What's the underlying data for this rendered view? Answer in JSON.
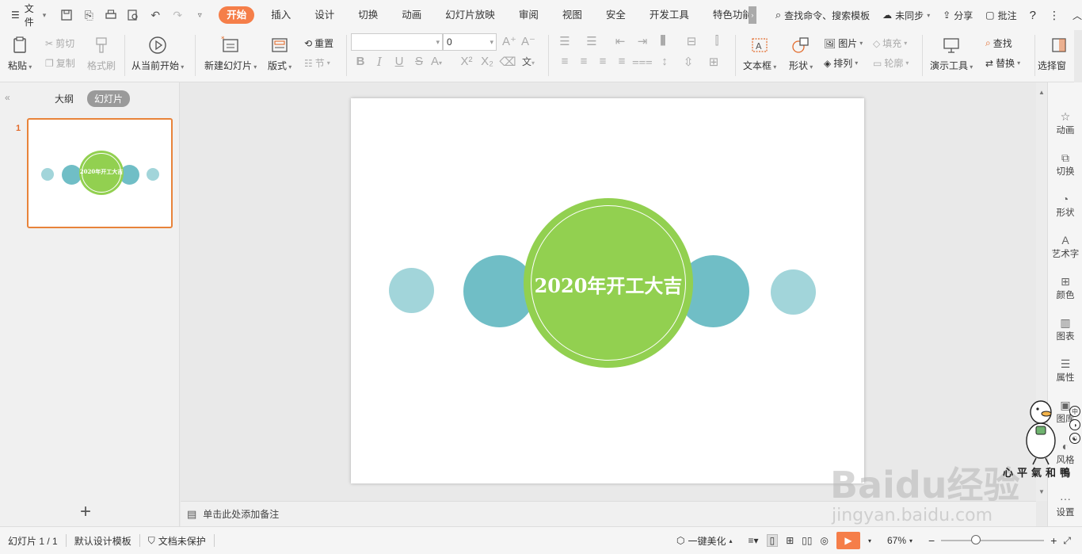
{
  "menubar": {
    "file": "文件",
    "tabs": [
      "开始",
      "插入",
      "设计",
      "切换",
      "动画",
      "幻灯片放映",
      "审阅",
      "视图",
      "安全",
      "开发工具",
      "特色功能"
    ],
    "search": "查找命令、搜索模板",
    "sync": "未同步",
    "share": "分享",
    "comment": "批注",
    "help": "?"
  },
  "ribbon": {
    "paste": "粘贴",
    "cut": "剪切",
    "copy": "复制",
    "format_painter": "格式刷",
    "play_from_current": "从当前开始",
    "new_slide": "新建幻灯片",
    "layout": "版式",
    "reset": "重置",
    "section": "节",
    "font_name": "",
    "font_size": "0",
    "textbox": "文本框",
    "shape": "形状",
    "picture": "图片",
    "fill": "填充",
    "arrange": "排列",
    "outline": "轮廓",
    "present_tools": "演示工具",
    "find": "查找",
    "replace": "替换",
    "select_pane": "选择窗"
  },
  "left_panel": {
    "outline_tab": "大纲",
    "slides_tab": "幻灯片",
    "slide_number": "1",
    "add_icon": "+"
  },
  "slide": {
    "title": "2020年开工大吉",
    "colors": {
      "green": "#92d050",
      "teal": "#70bec6",
      "light_teal": "#a2d5da"
    }
  },
  "notes": {
    "placeholder": "单击此处添加备注"
  },
  "right_sidebar": {
    "items": [
      "动画",
      "切换",
      "形状",
      "艺术字",
      "颜色",
      "图表",
      "属性",
      "图库",
      "风格",
      "设置"
    ]
  },
  "status": {
    "slide_count": "幻灯片 1 / 1",
    "template": "默认设计模板",
    "protect": "文档未保护",
    "beautify": "一键美化",
    "zoom": "67%"
  },
  "watermark": {
    "brand": "Baidu经验",
    "url": "jingyan.baidu.com",
    "author": "心平氣和鴨"
  }
}
